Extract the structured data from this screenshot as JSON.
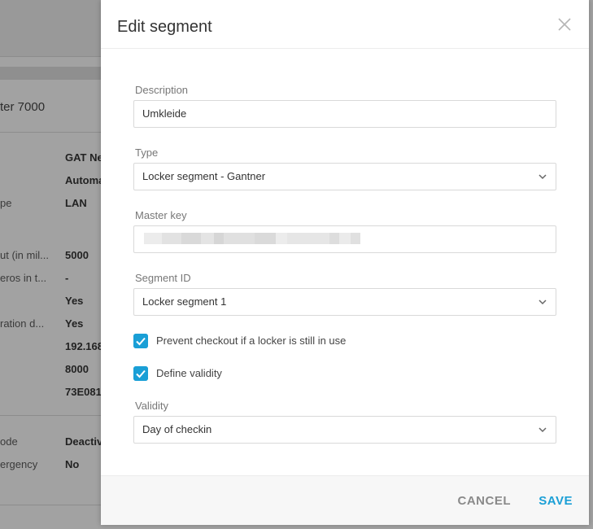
{
  "background": {
    "title_fragment": "ter 7000",
    "rows": [
      {
        "key": "",
        "value": "GAT Ne"
      },
      {
        "key": "",
        "value": "Automa"
      },
      {
        "key": "pe",
        "value": "LAN"
      },
      {
        "key": "ut (in mil...",
        "value": "5000"
      },
      {
        "key": "eros in t...",
        "value": "-"
      },
      {
        "key": "",
        "value": "Yes"
      },
      {
        "key": "ration d...",
        "value": "Yes"
      },
      {
        "key": "",
        "value": "192.168"
      },
      {
        "key": "",
        "value": "8000"
      },
      {
        "key": "",
        "value": "73E081"
      },
      {
        "key": "ode",
        "value": "Deactiv"
      },
      {
        "key": "ergency",
        "value": "No"
      }
    ]
  },
  "modal": {
    "title": "Edit segment",
    "close_icon": "close-icon",
    "fields": {
      "description": {
        "label": "Description",
        "value": "Umkleide"
      },
      "type": {
        "label": "Type",
        "value": "Locker segment - Gantner",
        "icon": "chevron-down-icon"
      },
      "master_key": {
        "label": "Master key",
        "value": "(obscured)"
      },
      "segment_id": {
        "label": "Segment ID",
        "value": "Locker segment 1",
        "icon": "chevron-down-icon"
      },
      "validity": {
        "label": "Validity",
        "value": "Day of checkin",
        "icon": "chevron-down-icon"
      }
    },
    "checkboxes": {
      "prevent_checkout": {
        "label": "Prevent checkout if a locker is still in use",
        "checked": true
      },
      "define_validity": {
        "label": "Define validity",
        "checked": true
      }
    },
    "footer": {
      "cancel_label": "CANCEL",
      "save_label": "SAVE"
    }
  },
  "colors": {
    "accent": "#1a9fd6",
    "overlay": "#a2a2a2",
    "cancel_text": "#8a8a8a"
  }
}
